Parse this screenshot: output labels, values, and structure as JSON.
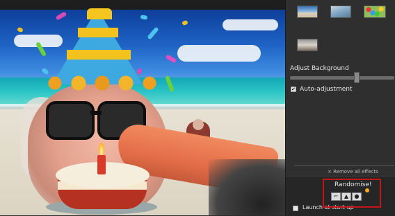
{
  "panel": {
    "adjust_background_label": "Adjust Background",
    "slider_level": 0.65,
    "auto_adjustment": {
      "label": "Auto-adjustment",
      "checked": true,
      "check_glyph": "✔"
    },
    "remove_effects_label": "× Remove all effects",
    "randomise_label": "Randomise!",
    "launch_at_startup": {
      "label": "Launch at start-up",
      "checked": false
    },
    "background_thumbnails": [
      "beach-1-icon",
      "beach-2-icon",
      "confetti-pattern-icon",
      "office-room-icon"
    ],
    "randomise_slots": [
      "glasses-icon",
      "hat-icon",
      "cake-icon"
    ],
    "highlight_color": "#c7141b",
    "accent_color": "#f5a623"
  },
  "preview": {
    "effects": [
      "party-hat",
      "laurel-garland",
      "sunglasses",
      "birthday-cake",
      "beach-background"
    ]
  }
}
